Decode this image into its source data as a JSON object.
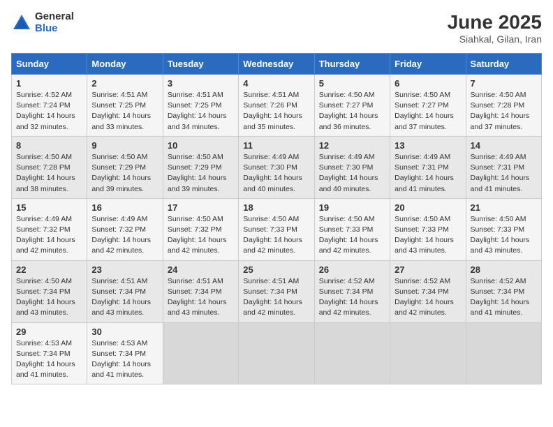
{
  "header": {
    "logo_general": "General",
    "logo_blue": "Blue",
    "month_title": "June 2025",
    "location": "Siahkal, Gilan, Iran"
  },
  "days_of_week": [
    "Sunday",
    "Monday",
    "Tuesday",
    "Wednesday",
    "Thursday",
    "Friday",
    "Saturday"
  ],
  "weeks": [
    [
      {
        "day": "1",
        "sunrise": "4:52 AM",
        "sunset": "7:24 PM",
        "daylight": "14 hours and 32 minutes."
      },
      {
        "day": "2",
        "sunrise": "4:51 AM",
        "sunset": "7:25 PM",
        "daylight": "14 hours and 33 minutes."
      },
      {
        "day": "3",
        "sunrise": "4:51 AM",
        "sunset": "7:25 PM",
        "daylight": "14 hours and 34 minutes."
      },
      {
        "day": "4",
        "sunrise": "4:51 AM",
        "sunset": "7:26 PM",
        "daylight": "14 hours and 35 minutes."
      },
      {
        "day": "5",
        "sunrise": "4:50 AM",
        "sunset": "7:27 PM",
        "daylight": "14 hours and 36 minutes."
      },
      {
        "day": "6",
        "sunrise": "4:50 AM",
        "sunset": "7:27 PM",
        "daylight": "14 hours and 37 minutes."
      },
      {
        "day": "7",
        "sunrise": "4:50 AM",
        "sunset": "7:28 PM",
        "daylight": "14 hours and 37 minutes."
      }
    ],
    [
      {
        "day": "8",
        "sunrise": "4:50 AM",
        "sunset": "7:28 PM",
        "daylight": "14 hours and 38 minutes."
      },
      {
        "day": "9",
        "sunrise": "4:50 AM",
        "sunset": "7:29 PM",
        "daylight": "14 hours and 39 minutes."
      },
      {
        "day": "10",
        "sunrise": "4:50 AM",
        "sunset": "7:29 PM",
        "daylight": "14 hours and 39 minutes."
      },
      {
        "day": "11",
        "sunrise": "4:49 AM",
        "sunset": "7:30 PM",
        "daylight": "14 hours and 40 minutes."
      },
      {
        "day": "12",
        "sunrise": "4:49 AM",
        "sunset": "7:30 PM",
        "daylight": "14 hours and 40 minutes."
      },
      {
        "day": "13",
        "sunrise": "4:49 AM",
        "sunset": "7:31 PM",
        "daylight": "14 hours and 41 minutes."
      },
      {
        "day": "14",
        "sunrise": "4:49 AM",
        "sunset": "7:31 PM",
        "daylight": "14 hours and 41 minutes."
      }
    ],
    [
      {
        "day": "15",
        "sunrise": "4:49 AM",
        "sunset": "7:32 PM",
        "daylight": "14 hours and 42 minutes."
      },
      {
        "day": "16",
        "sunrise": "4:49 AM",
        "sunset": "7:32 PM",
        "daylight": "14 hours and 42 minutes."
      },
      {
        "day": "17",
        "sunrise": "4:50 AM",
        "sunset": "7:32 PM",
        "daylight": "14 hours and 42 minutes."
      },
      {
        "day": "18",
        "sunrise": "4:50 AM",
        "sunset": "7:33 PM",
        "daylight": "14 hours and 42 minutes."
      },
      {
        "day": "19",
        "sunrise": "4:50 AM",
        "sunset": "7:33 PM",
        "daylight": "14 hours and 42 minutes."
      },
      {
        "day": "20",
        "sunrise": "4:50 AM",
        "sunset": "7:33 PM",
        "daylight": "14 hours and 43 minutes."
      },
      {
        "day": "21",
        "sunrise": "4:50 AM",
        "sunset": "7:33 PM",
        "daylight": "14 hours and 43 minutes."
      }
    ],
    [
      {
        "day": "22",
        "sunrise": "4:50 AM",
        "sunset": "7:34 PM",
        "daylight": "14 hours and 43 minutes."
      },
      {
        "day": "23",
        "sunrise": "4:51 AM",
        "sunset": "7:34 PM",
        "daylight": "14 hours and 43 minutes."
      },
      {
        "day": "24",
        "sunrise": "4:51 AM",
        "sunset": "7:34 PM",
        "daylight": "14 hours and 43 minutes."
      },
      {
        "day": "25",
        "sunrise": "4:51 AM",
        "sunset": "7:34 PM",
        "daylight": "14 hours and 42 minutes."
      },
      {
        "day": "26",
        "sunrise": "4:52 AM",
        "sunset": "7:34 PM",
        "daylight": "14 hours and 42 minutes."
      },
      {
        "day": "27",
        "sunrise": "4:52 AM",
        "sunset": "7:34 PM",
        "daylight": "14 hours and 42 minutes."
      },
      {
        "day": "28",
        "sunrise": "4:52 AM",
        "sunset": "7:34 PM",
        "daylight": "14 hours and 41 minutes."
      }
    ],
    [
      {
        "day": "29",
        "sunrise": "4:53 AM",
        "sunset": "7:34 PM",
        "daylight": "14 hours and 41 minutes."
      },
      {
        "day": "30",
        "sunrise": "4:53 AM",
        "sunset": "7:34 PM",
        "daylight": "14 hours and 41 minutes."
      },
      null,
      null,
      null,
      null,
      null
    ]
  ]
}
